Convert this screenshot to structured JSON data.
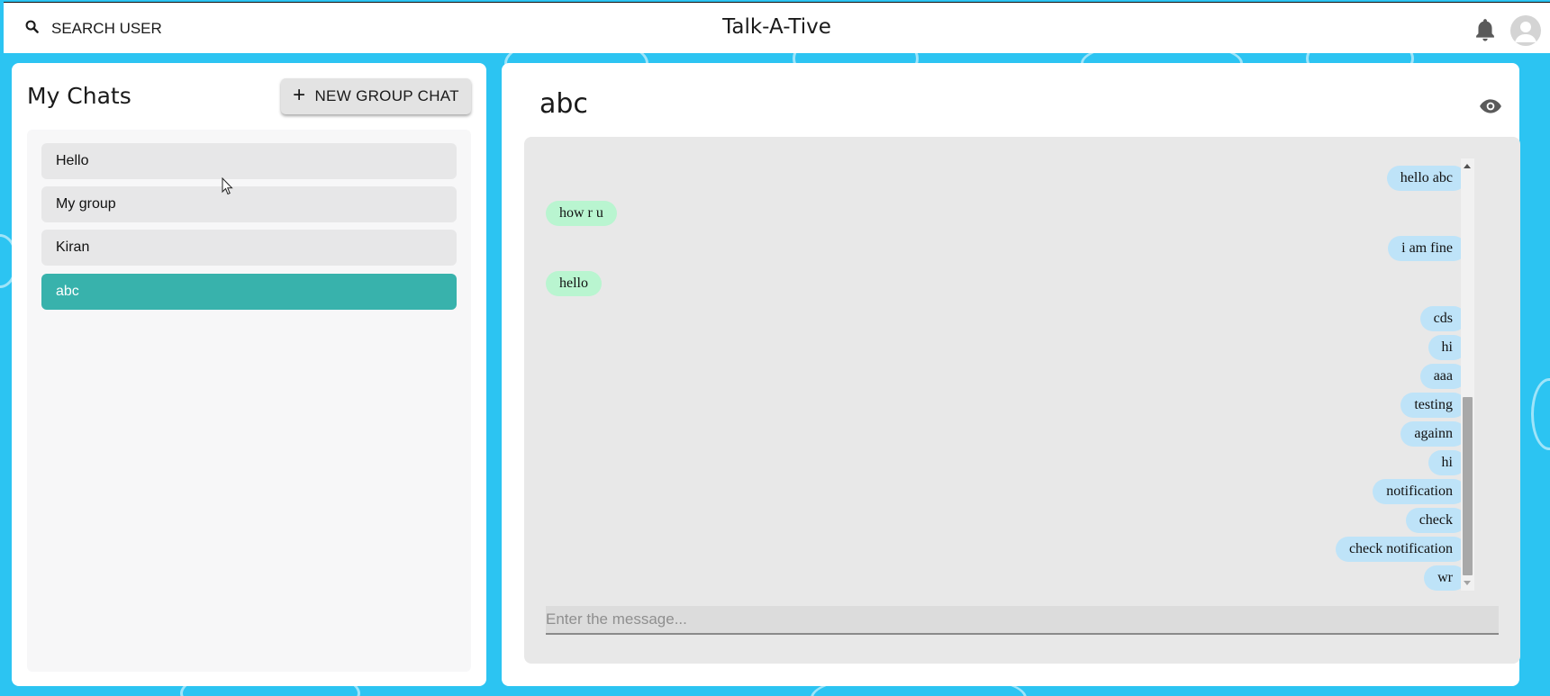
{
  "header": {
    "search_label": "SEARCH USER",
    "app_title": "Talk-A-Tive",
    "icons": {
      "search": "search-icon",
      "notifications": "bell-icon",
      "profile": "avatar-icon"
    }
  },
  "sidebar": {
    "title": "My Chats",
    "new_group_label": "NEW GROUP CHAT",
    "chats": [
      {
        "name": "Hello",
        "active": false
      },
      {
        "name": "My group",
        "active": false
      },
      {
        "name": "Kiran",
        "active": false
      },
      {
        "name": "abc",
        "active": true
      }
    ]
  },
  "chat": {
    "title": "abc",
    "view_icon": "eye-icon",
    "messages": [
      {
        "text": "hello abc",
        "from": "me"
      },
      {
        "text": "how r u",
        "from": "other"
      },
      {
        "text": "i am fine",
        "from": "me"
      },
      {
        "text": "hello",
        "from": "other"
      },
      {
        "text": "cds",
        "from": "me"
      },
      {
        "text": "hi",
        "from": "me"
      },
      {
        "text": "aaa",
        "from": "me"
      },
      {
        "text": "testing",
        "from": "me"
      },
      {
        "text": "againn",
        "from": "me"
      },
      {
        "text": "hi",
        "from": "me"
      },
      {
        "text": "notification",
        "from": "me"
      },
      {
        "text": "check",
        "from": "me"
      },
      {
        "text": "check notification",
        "from": "me"
      },
      {
        "text": "wr",
        "from": "me"
      }
    ],
    "input_placeholder": "Enter the message...",
    "input_value": ""
  },
  "colors": {
    "background": "#2cc4f2",
    "active_chat": "#38b2ac",
    "sent_bubble": "#bee3f8",
    "received_bubble": "#b9f5d0"
  }
}
